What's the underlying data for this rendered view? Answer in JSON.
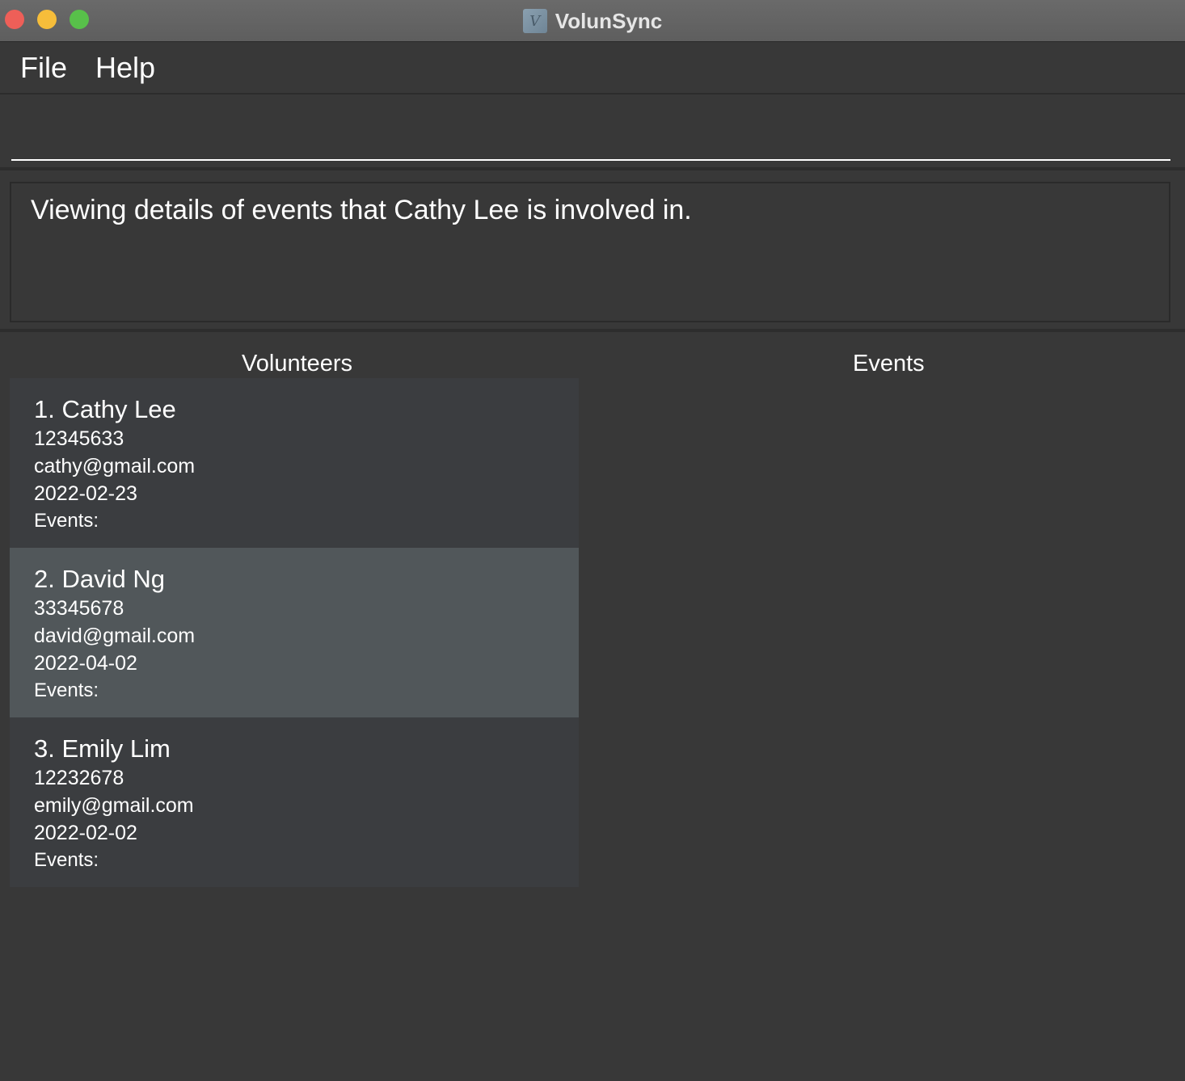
{
  "window": {
    "title": "VolunSync",
    "app_icon_glyph": "V"
  },
  "menu": {
    "file": "File",
    "help": "Help"
  },
  "command": {
    "value": "",
    "placeholder": ""
  },
  "result": {
    "message": "Viewing details of events that Cathy Lee is involved in."
  },
  "panels": {
    "volunteers_title": "Volunteers",
    "events_title": "Events"
  },
  "volunteers": [
    {
      "name": "1. Cathy Lee",
      "phone": "12345633",
      "email": "cathy@gmail.com",
      "date": "2022-02-23",
      "events_label": "Events:"
    },
    {
      "name": "2. David Ng",
      "phone": "33345678",
      "email": "david@gmail.com",
      "date": "2022-04-02",
      "events_label": "Events:"
    },
    {
      "name": "3. Emily Lim",
      "phone": "12232678",
      "email": "emily@gmail.com",
      "date": "2022-02-02",
      "events_label": "Events:"
    }
  ],
  "colors": {
    "background": "#383838",
    "card": "#3b3d40",
    "card_selected": "#51575a",
    "close": "#ee5f58",
    "minimize": "#f6bd3a",
    "maximize": "#58c04a"
  }
}
